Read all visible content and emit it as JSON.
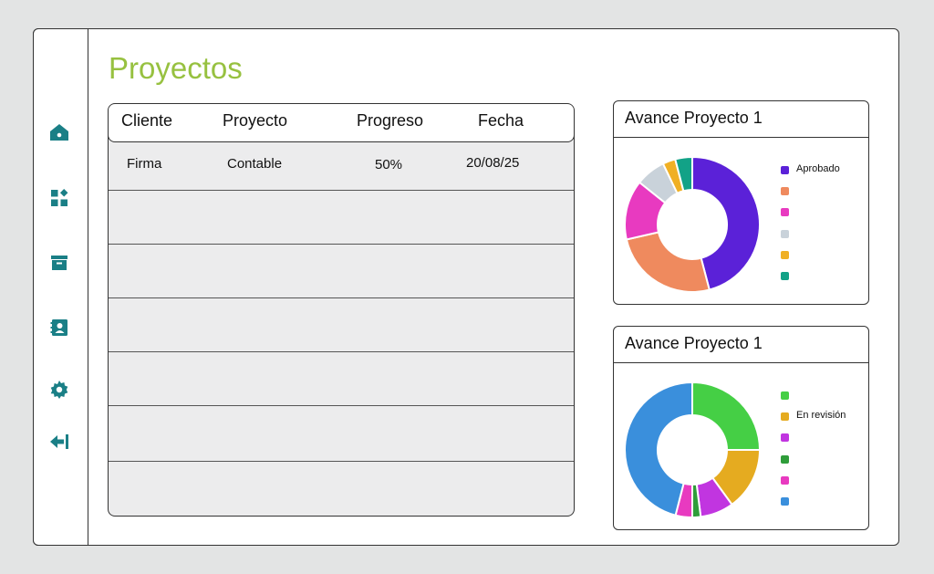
{
  "page_title": "Proyectos",
  "sidebar": {
    "icons": [
      "home-icon",
      "apps-icon",
      "archive-icon",
      "contacts-icon",
      "settings-icon",
      "logout-icon"
    ],
    "accent": "#1a7f86"
  },
  "table": {
    "headers": [
      "Cliente",
      "Proyecto",
      "Progreso",
      "Fecha"
    ],
    "rows": [
      [
        "Firma",
        "Contable",
        "50%",
        "20/08/25"
      ]
    ]
  },
  "chart_data": [
    {
      "type": "pie",
      "title": "Avance Proyecto 1",
      "donut": true,
      "slices": [
        {
          "label": "Aprobado",
          "value": 45,
          "color": "#5b21d8"
        },
        {
          "label": "",
          "value": 25,
          "color": "#ef8a5e"
        },
        {
          "label": "",
          "value": 14,
          "color": "#e83ac0"
        },
        {
          "label": "",
          "value": 7,
          "color": "#c9d2da"
        },
        {
          "label": "",
          "value": 3,
          "color": "#f0b024"
        },
        {
          "label": "",
          "value": 4,
          "color": "#12a287"
        }
      ],
      "legend_order": [
        0,
        1,
        2,
        3,
        4,
        5
      ]
    },
    {
      "type": "pie",
      "title": "Avance Proyecto 1",
      "donut": true,
      "slices": [
        {
          "label": "",
          "value": 25,
          "color": "#45cf45"
        },
        {
          "label": "En revisión",
          "value": 15,
          "color": "#e5ab20"
        },
        {
          "label": "",
          "value": 8,
          "color": "#c135e0"
        },
        {
          "label": "",
          "value": 2,
          "color": "#2f9d3a"
        },
        {
          "label": "",
          "value": 4,
          "color": "#e83ac0"
        },
        {
          "label": "",
          "value": 46,
          "color": "#3a8fdc"
        }
      ],
      "legend_order": [
        0,
        1,
        2,
        3,
        4,
        5
      ]
    }
  ]
}
